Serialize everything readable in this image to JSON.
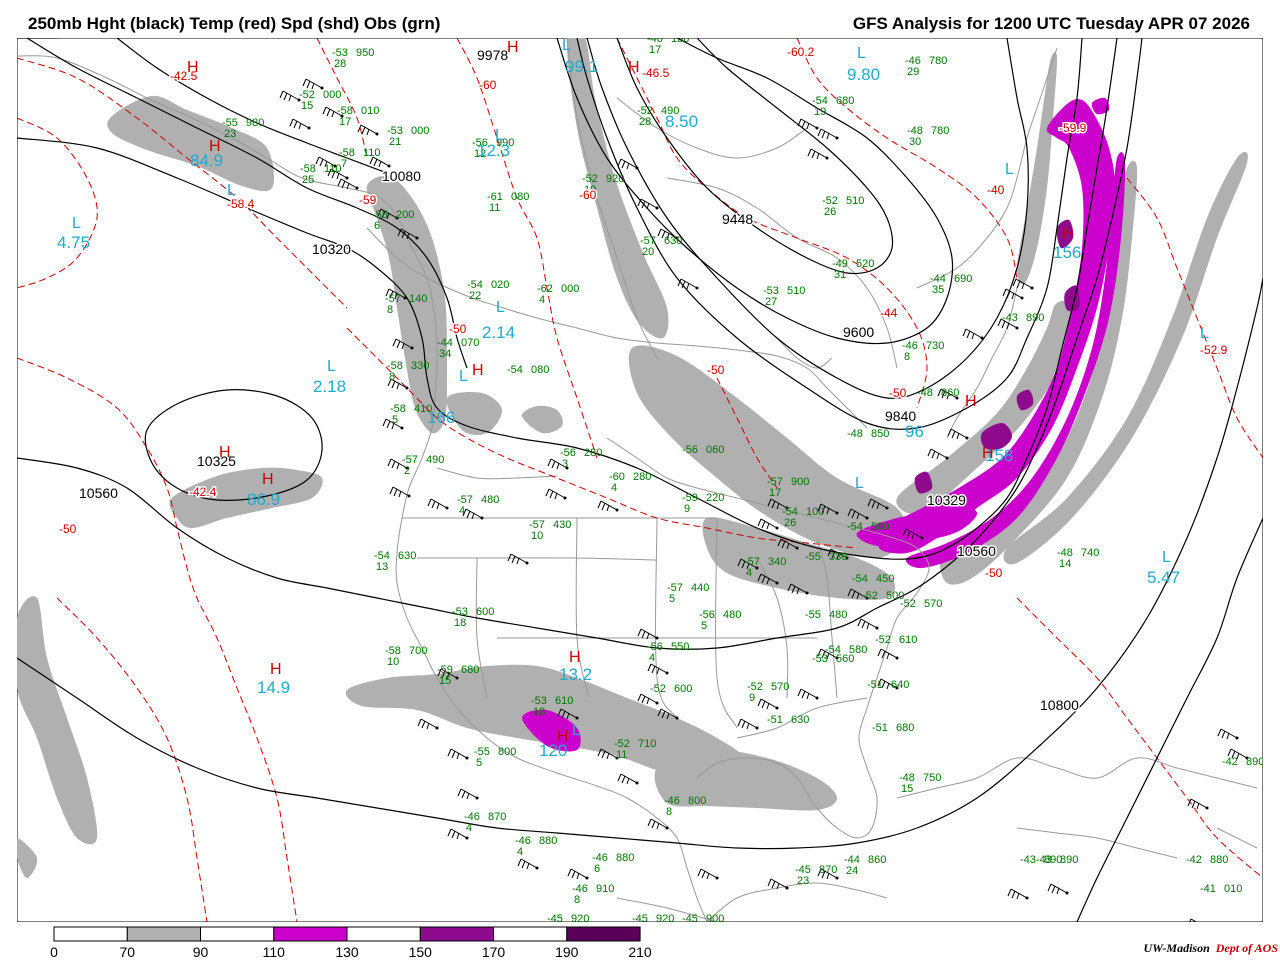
{
  "header": {
    "left_title": "250mb Hght (black) Temp (red) Spd (shd) Obs (grn)",
    "right_title": "GFS Analysis for 1200 UTC Tuesday  APR 07 2026"
  },
  "colors": {
    "height_contour": "#000000",
    "temp_contour": "#cc0000",
    "obs": "#007700",
    "speed_label": "#22aacc",
    "geography": "#999999",
    "speed_70_90": "#b0b0b0",
    "speed_110_130": "#cc00cc",
    "speed_150_170": "#8e0b8e",
    "speed_190_210": "#5a005a"
  },
  "legend": {
    "ticks": [
      "0",
      "70",
      "90",
      "110",
      "130",
      "150",
      "170",
      "190",
      "210"
    ],
    "shades": [
      "#ffffff",
      "#b0b0b0",
      "#ffffff",
      "#cc00cc",
      "#ffffff",
      "#8e0b8e",
      "#ffffff",
      "#5a005a"
    ]
  },
  "credit": {
    "org": "UW-Madison",
    "dept": "Dept of AOS"
  },
  "height_labels": [
    "9978",
    "10080",
    "10320",
    "9448",
    "10325",
    "10560",
    "9600",
    "9840",
    "10329",
    "10560",
    "10800"
  ],
  "temp_labels": [
    "-42.5",
    "-58.4",
    "-60",
    "-60.2",
    "-46.5",
    "-59",
    "-40",
    "-59.9",
    "-60",
    "-50",
    "-44",
    "-50",
    "-50",
    "-52.9",
    "-50",
    "-50",
    "-42.4"
  ],
  "speed_labels": [
    "84.9",
    "4.75",
    "2.18",
    "12.3",
    "99.1",
    "156",
    "9.80",
    "8.50",
    "2.14",
    "166",
    "96",
    "158",
    "5.47",
    "14.9",
    "13.2",
    "120",
    "86.9"
  ],
  "center_letters": [
    "H",
    "H",
    "L",
    "L",
    "H",
    "L",
    "L",
    "H",
    "H",
    "L",
    "H",
    "L",
    "L",
    "H",
    "L",
    "L",
    "L",
    "H",
    "L",
    "H",
    "L",
    "H",
    "H",
    "H",
    "H",
    "L"
  ],
  "obs": [
    {
      "t": "-53",
      "d": "28",
      "h": "950"
    },
    {
      "t": "-52",
      "d": "15",
      "h": "000"
    },
    {
      "t": "-58",
      "d": "17",
      "h": "010"
    },
    {
      "t": "-53",
      "d": "21",
      "h": "000"
    },
    {
      "t": "-56",
      "d": "12",
      "h": "990"
    },
    {
      "t": "-52",
      "d": "10",
      "h": "920"
    },
    {
      "t": "-46",
      "d": "17",
      "h": "130"
    },
    {
      "t": "-52",
      "d": "28",
      "h": "490"
    },
    {
      "t": "-54",
      "d": "19",
      "h": "680"
    },
    {
      "t": "-46",
      "d": "29",
      "h": "780"
    },
    {
      "t": "-48",
      "d": "30",
      "h": "780"
    },
    {
      "t": "-55",
      "d": "23",
      "h": "980"
    },
    {
      "t": "-58",
      "d": "25",
      "h": "110"
    },
    {
      "t": "-58",
      "d": "7",
      "h": "110"
    },
    {
      "t": "-58",
      "d": "6",
      "h": "200"
    },
    {
      "t": "-61",
      "d": "11",
      "h": "080"
    },
    {
      "t": "-57",
      "d": "20",
      "h": "630"
    },
    {
      "t": "-52",
      "d": "26",
      "h": "510"
    },
    {
      "t": "-49",
      "d": "31",
      "h": "520"
    },
    {
      "t": "-44",
      "d": "35",
      "h": "690"
    },
    {
      "t": "-54",
      "d": "22",
      "h": "020"
    },
    {
      "t": "-62",
      "d": "4",
      "h": "000"
    },
    {
      "t": "-53",
      "d": "27",
      "h": "510"
    },
    {
      "t": "-57",
      "d": "8",
      "h": "140"
    },
    {
      "t": "-44",
      "d": "34",
      "h": "070"
    },
    {
      "t": "-46",
      "d": "8",
      "h": "730"
    },
    {
      "t": "-43",
      "d": "",
      "h": "890"
    },
    {
      "t": "-58",
      "d": "8",
      "h": "330"
    },
    {
      "t": "-54",
      "d": "",
      "h": "080"
    },
    {
      "t": "-48",
      "d": "",
      "h": "860"
    },
    {
      "t": "-58",
      "d": "5",
      "h": "410"
    },
    {
      "t": "-48",
      "d": "",
      "h": "850"
    },
    {
      "t": "-57",
      "d": "2",
      "h": "490"
    },
    {
      "t": "-56",
      "d": "3",
      "h": "280"
    },
    {
      "t": "-60",
      "d": "4",
      "h": "280"
    },
    {
      "t": "-56",
      "d": "",
      "h": "060"
    },
    {
      "t": "-57",
      "d": "4",
      "h": "480"
    },
    {
      "t": "-57",
      "d": "10",
      "h": "430"
    },
    {
      "t": "-59",
      "d": "9",
      "h": "220"
    },
    {
      "t": "-57",
      "d": "17",
      "h": "900"
    },
    {
      "t": "-54",
      "d": "26",
      "h": "100"
    },
    {
      "t": "-54",
      "d": "",
      "h": "580"
    },
    {
      "t": "-54",
      "d": "13",
      "h": "630"
    },
    {
      "t": "-48",
      "d": "14",
      "h": "740"
    },
    {
      "t": "-53",
      "d": "18",
      "h": "600"
    },
    {
      "t": "-57",
      "d": "4",
      "h": "340"
    },
    {
      "t": "-55",
      "d": "",
      "h": "330"
    },
    {
      "t": "-54",
      "d": "",
      "h": "450"
    },
    {
      "t": "-52",
      "d": "",
      "h": "500"
    },
    {
      "t": "-52",
      "d": "",
      "h": "570"
    },
    {
      "t": "-57",
      "d": "5",
      "h": "440"
    },
    {
      "t": "-56",
      "d": "5",
      "h": "480"
    },
    {
      "t": "-55",
      "d": "",
      "h": "480"
    },
    {
      "t": "-58",
      "d": "10",
      "h": "700"
    },
    {
      "t": "-59",
      "d": "15",
      "h": "680"
    },
    {
      "t": "-52",
      "d": "",
      "h": "610"
    },
    {
      "t": "-56",
      "d": "4",
      "h": "550"
    },
    {
      "t": "-54",
      "d": "",
      "h": "580"
    },
    {
      "t": "-53",
      "d": "",
      "h": "560"
    },
    {
      "t": "-52",
      "d": "",
      "h": "600"
    },
    {
      "t": "-52",
      "d": "9",
      "h": "570"
    },
    {
      "t": "-51",
      "d": "",
      "h": "640"
    },
    {
      "t": "-53",
      "d": "18",
      "h": "610"
    },
    {
      "t": "-51",
      "d": "",
      "h": "630"
    },
    {
      "t": "-51",
      "d": "",
      "h": "680"
    },
    {
      "t": "-55",
      "d": "5",
      "h": "800"
    },
    {
      "t": "-52",
      "d": "11",
      "h": "710"
    },
    {
      "t": "-48",
      "d": "15",
      "h": "750"
    },
    {
      "t": "-46",
      "d": "8",
      "h": "800"
    },
    {
      "t": "-43",
      "d": "",
      "h": "890"
    },
    {
      "t": "-42",
      "d": "",
      "h": "890"
    },
    {
      "t": "-42",
      "d": "",
      "h": "880"
    },
    {
      "t": "-46",
      "d": "4",
      "h": "870"
    },
    {
      "t": "-46",
      "d": "4",
      "h": "880"
    },
    {
      "t": "-46",
      "d": "6",
      "h": "880"
    },
    {
      "t": "-45",
      "d": "23",
      "h": "870"
    },
    {
      "t": "-44",
      "d": "24",
      "h": "860"
    },
    {
      "t": "-43",
      "d": "",
      "h": "890"
    },
    {
      "t": "-46",
      "d": "8",
      "h": "910"
    },
    {
      "t": "-45",
      "d": "",
      "h": "920"
    },
    {
      "t": "-45",
      "d": "",
      "h": "920"
    },
    {
      "t": "-45",
      "d": "",
      "h": "900"
    },
    {
      "t": "-41",
      "d": "",
      "h": "010"
    }
  ]
}
